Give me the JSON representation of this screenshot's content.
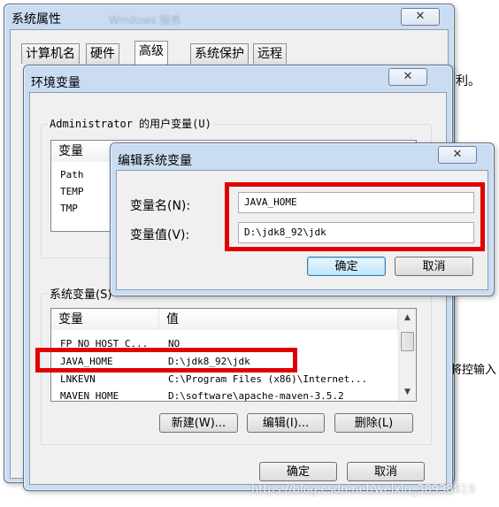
{
  "props_window": {
    "title": "系统属性",
    "bg_title": "Windows 服务",
    "close": "✕",
    "tabs": [
      "计算机名",
      "硬件",
      "高级",
      "系统保护",
      "远程"
    ],
    "side_text_1": "利。",
    "side_text_2": "将控输入"
  },
  "env_window": {
    "title": "环境变量",
    "close": "✕",
    "user_group_label": "Administrator 的用户变量(U)",
    "user_list": {
      "col_var": "变量",
      "rows": [
        "Path",
        "TEMP",
        "TMP"
      ]
    },
    "sys_group_label": "系统变量(S)",
    "sys_list": {
      "col_var": "变量",
      "col_val": "值",
      "rows": [
        {
          "name": "FP_NO_HOST_C...",
          "value": "NO"
        },
        {
          "name": "JAVA_HOME",
          "value": "D:\\jdk8_92\\jdk"
        },
        {
          "name": "LNKEVN",
          "value": "C:\\Program Files (x86)\\Internet..."
        },
        {
          "name": "MAVEN_HOME",
          "value": "D:\\software\\apache-maven-3.5.2"
        }
      ]
    },
    "btn_new": "新建(W)...",
    "btn_edit": "编辑(I)...",
    "btn_delete": "删除(L)",
    "btn_ok": "确定",
    "btn_cancel": "取消"
  },
  "edit_dialog": {
    "title": "编辑系统变量",
    "close": "✕",
    "name_label": "变量名(N):",
    "name_value": "JAVA_HOME",
    "value_label": "变量值(V):",
    "value_value": "D:\\jdk8_92\\jdk",
    "btn_ok": "确定",
    "btn_cancel": "取消"
  },
  "watermark": "https://blog.csdn.net/weixin_38938819",
  "colors": {
    "highlight": "#e00000",
    "window_frame": "#c9dcf2"
  }
}
